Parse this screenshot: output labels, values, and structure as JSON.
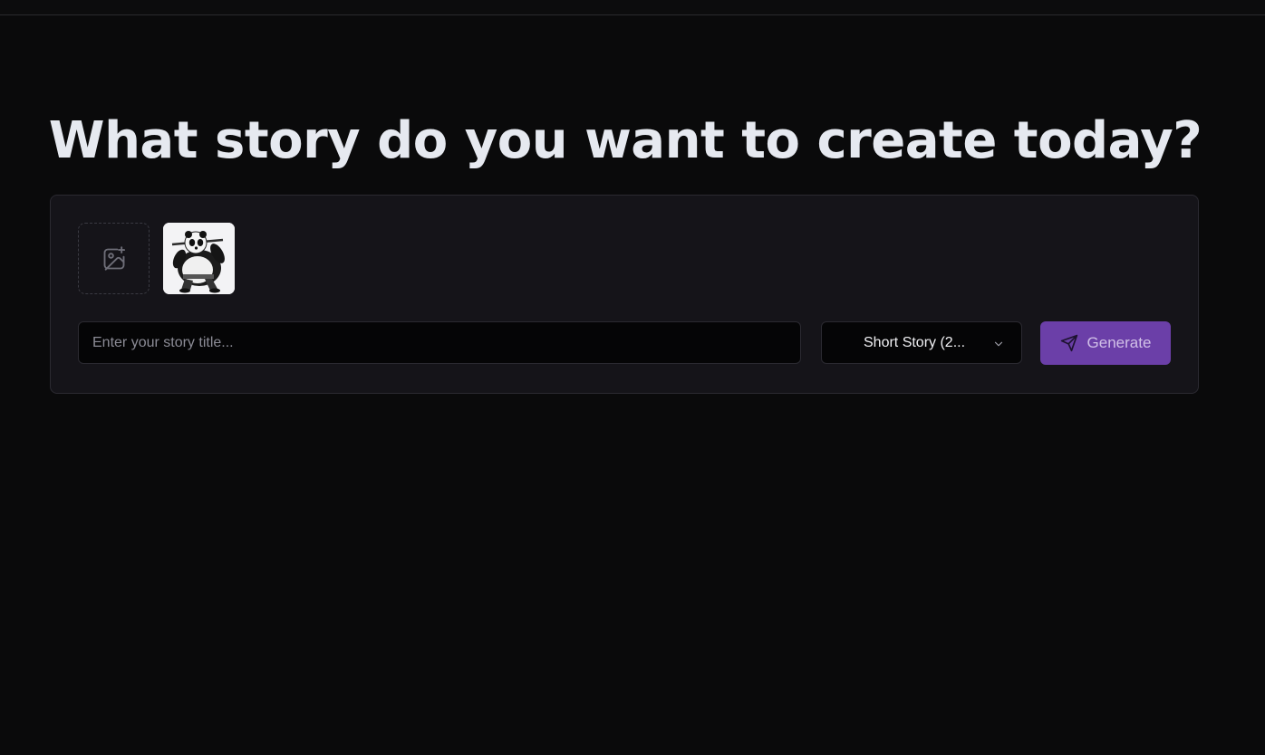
{
  "header": {
    "headline": "What story do you want to create today?"
  },
  "composer": {
    "upload_icon": "image-plus-icon",
    "uploaded_image": "panda-character-thumbnail",
    "title_placeholder": "Enter your story title...",
    "title_value": "",
    "length_select": {
      "selected": "Short Story (2..."
    },
    "generate": {
      "label": "Generate",
      "icon": "send-icon",
      "color": "#6b3fa8"
    }
  },
  "colors": {
    "background": "#0a0a0b",
    "card": "#151419",
    "accent": "#6b3fa8"
  }
}
